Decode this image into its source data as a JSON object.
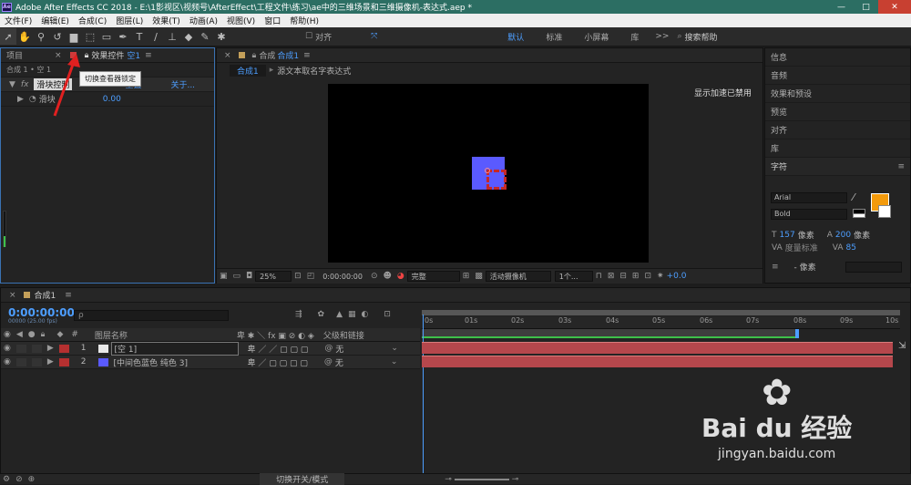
{
  "titlebar": {
    "title": "Adobe After Effects CC 2018 - E:\\1影视区\\视频号\\AfterEffect\\工程文件\\练习\\ae中的三维场景和三维摄像机-表达式.aep *",
    "logo": "Ae",
    "minimize": "—",
    "maximize": "□",
    "close": "✕"
  },
  "menu": [
    "文件(F)",
    "编辑(E)",
    "合成(C)",
    "图层(L)",
    "效果(T)",
    "动画(A)",
    "视图(V)",
    "窗口",
    "帮助(H)"
  ],
  "toolbar": {
    "snap_label": "对齐",
    "search_placeholder": "搜索帮助",
    "workspaces": [
      "默认",
      "标准",
      "小屏幕",
      "库"
    ],
    "more": ">>"
  },
  "left_panel": {
    "tab_project": "项目",
    "tab_effects": "效果控件",
    "tab_effects_target": "空1",
    "tooltip": "切换查看器锁定",
    "breadcrumb": "合成 1 • 空 1",
    "effect_name": "滑块控制",
    "effect_reset": "重置",
    "effect_about": "关于...",
    "slider_label": "滑块",
    "slider_value": "0.00"
  },
  "composition": {
    "tab_label": "合成",
    "tab_name": "合成1",
    "breadcrumb_comp": "合成1",
    "breadcrumb_text": "源文本取名字表达式",
    "accel_notice": "显示加速已禁用",
    "zoom": "25%",
    "timecode": "0:00:00:00",
    "resolution": "完整",
    "camera": "活动摄像机",
    "views": "1个...",
    "exposure": "+0.0"
  },
  "right_panel": {
    "items": [
      "信息",
      "音频",
      "效果和预设",
      "预览",
      "对齐",
      "库"
    ],
    "char_title": "字符",
    "font": "Arial",
    "style": "Bold",
    "size_value": "157",
    "size_unit": "像素",
    "leading_value": "200",
    "leading_unit": "像素",
    "kerning": "度量标准",
    "tracking": "85",
    "stroke_width": "- 像素",
    "fill_color": "#f39a0b"
  },
  "timeline": {
    "tab_name": "合成1",
    "timecode": "0:00:00:00",
    "fps": "00000 (25.00 fps)",
    "search_placeholder": "ρ",
    "col_name": "图层名称",
    "col_parent": "父级和链接",
    "layers": [
      {
        "num": "1",
        "name": "[空 1]",
        "parent": "无",
        "color": "#e8e8e8"
      },
      {
        "num": "2",
        "name": "[中间色蓝色 纯色 3]",
        "parent": "无",
        "color": "#5a5aff"
      }
    ],
    "ticks": [
      "0s",
      "01s",
      "02s",
      "03s",
      "04s",
      "05s",
      "06s",
      "07s",
      "08s",
      "09s",
      "10s"
    ],
    "bottom_label": "切换开关/模式"
  },
  "watermark": {
    "brand": "Bai du 经验",
    "url": "jingyan.baidu.com"
  }
}
